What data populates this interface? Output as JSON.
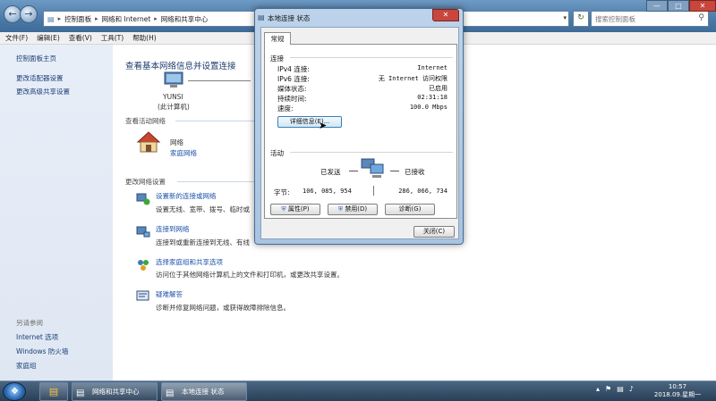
{
  "explorer": {
    "address": [
      "控制面板",
      "网络和 Internet",
      "网络和共享中心"
    ],
    "search_placeholder": "搜索控制面板",
    "menu": [
      "文件(F)",
      "编辑(E)",
      "查看(V)",
      "工具(T)",
      "帮助(H)"
    ],
    "sidebar": {
      "links": [
        "控制面板主页",
        "更改适配器设置",
        "更改高级共享设置"
      ],
      "see_also_title": "另请参阅",
      "see_also": [
        "Internet 选项",
        "Windows 防火墙",
        "家庭组"
      ]
    },
    "main": {
      "title": "查看基本网络信息并设置连接",
      "computer_name": "YUNSI",
      "computer_sub": "(此计算机)",
      "active_networks_title": "查看活动网络",
      "network_name": "网络",
      "network_type": "家庭网络",
      "change_settings_title": "更改网络设置",
      "tasks": [
        {
          "link": "设置新的连接或网络",
          "desc": "设置无线、宽带、拨号、临时或"
        },
        {
          "link": "连接到网络",
          "desc": "连接到或重新连接到无线、有线"
        },
        {
          "link": "选择家庭组和共享选项",
          "desc": "访问位于其他网络计算机上的文件和打印机，或更改共享设置。"
        },
        {
          "link": "疑难解答",
          "desc": "诊断并修复网络问题，或获得故障排除信息。"
        }
      ]
    }
  },
  "dialog": {
    "title": "本地连接 状态",
    "tab": "常规",
    "connection_title": "连接",
    "rows": [
      {
        "label": "IPv4 连接:",
        "value": "Internet"
      },
      {
        "label": "IPv6 连接:",
        "value": "无 Internet 访问权限"
      },
      {
        "label": "媒体状态:",
        "value": "已启用"
      },
      {
        "label": "持续时间:",
        "value": "02:31:18"
      },
      {
        "label": "速度:",
        "value": "100.0 Mbps"
      }
    ],
    "details_btn": "详细信息(E)...",
    "activity_title": "活动",
    "sent_label": "已发送",
    "received_label": "已接收",
    "bytes_label": "字节:",
    "bytes_sent": "106, 085, 954",
    "bytes_received": "286, 066, 734",
    "properties_btn": "属性(P)",
    "disable_btn": "禁用(D)",
    "diagnose_btn": "诊断(G)",
    "close_btn": "关闭(C)"
  },
  "taskbar": {
    "items": [
      "网络和共享中心",
      "本地连接 状态"
    ],
    "time": "10:57",
    "date": "2018.09.星期一"
  }
}
